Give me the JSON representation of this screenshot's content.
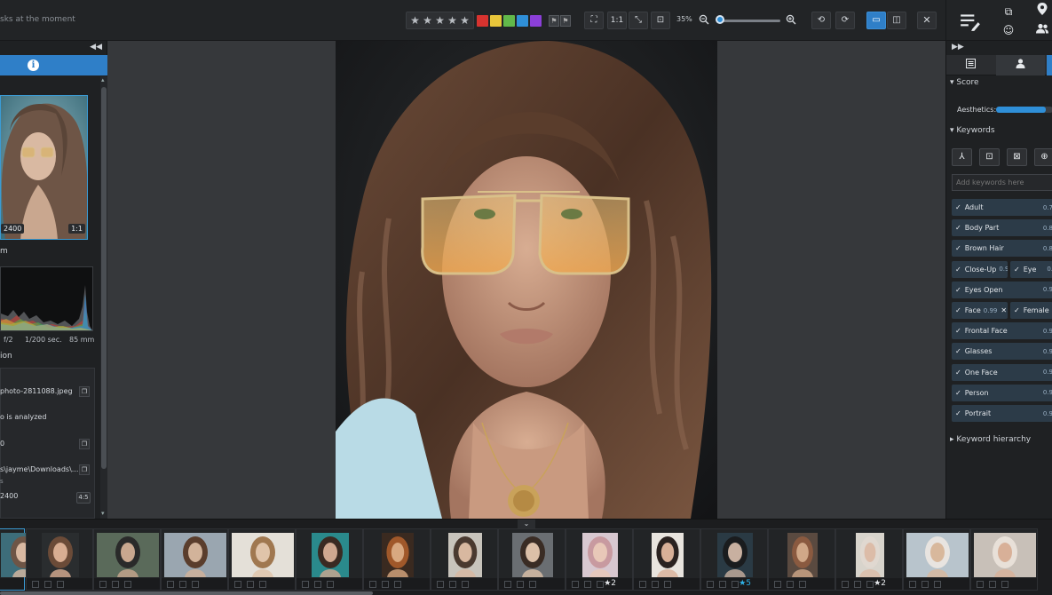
{
  "topbar": {
    "task_text": "sks at the moment",
    "rating_stars": [
      "★",
      "★",
      "★",
      "★",
      "★"
    ],
    "color_swatches": [
      "#d8332f",
      "#e8c53a",
      "#62b84a",
      "#2f8fd8",
      "#8b3fd8"
    ],
    "btn_fit": "⛶",
    "btn_1to1": "1:1",
    "btn_compress": "⤡",
    "btn_fill": "⊡",
    "zoom_value": "35%",
    "zoom_fraction": 0.35
  },
  "left_panel": {
    "preview_size": "2400",
    "preview_ratio": "1:1",
    "histogram_label": "m",
    "exif": {
      "aperture": "f/2",
      "shutter": "1/200 sec.",
      "focal": "85 mm"
    },
    "section_label": "ion",
    "filename": "photo-2811088.jpeg",
    "status": "o is analyzed",
    "value_0": "0",
    "path": "s\\jayme\\Downloads\\...",
    "path_sub": "s",
    "dims": "2400",
    "ratio": "4:5"
  },
  "right_panel": {
    "score_heading": "Score",
    "aesthetics_label": "Aesthetics:",
    "aesthetics_value": 0.88,
    "keywords_heading": "Keywords",
    "keyword_placeholder": "Add keywords here",
    "keyword_hierarchy": "Keyword hierarchy",
    "keywords": [
      [
        {
          "label": "Adult",
          "conf": "0.7"
        }
      ],
      [
        {
          "label": "Body Part",
          "conf": "0.8"
        }
      ],
      [
        {
          "label": "Brown Hair",
          "conf": "0.8"
        }
      ],
      [
        {
          "label": "Close-Up",
          "conf": "0.98",
          "x": true
        },
        {
          "label": "Eye",
          "conf": "0."
        }
      ],
      [
        {
          "label": "Eyes Open",
          "conf": "0.9"
        }
      ],
      [
        {
          "label": "Face",
          "conf": "0.99",
          "x": true
        },
        {
          "label": "Female",
          "conf": "0."
        }
      ],
      [
        {
          "label": "Frontal Face",
          "conf": "0.9"
        }
      ],
      [
        {
          "label": "Glasses",
          "conf": "0.9"
        }
      ],
      [
        {
          "label": "One Face",
          "conf": "0.9"
        }
      ],
      [
        {
          "label": "Person",
          "conf": "0.9"
        }
      ],
      [
        {
          "label": "Portrait",
          "conf": "0.9"
        }
      ]
    ]
  },
  "filmstrip": {
    "ratings": [
      "",
      "",
      "",
      "",
      "",
      "",
      "",
      "",
      "",
      "★2",
      "",
      "★5",
      "",
      "★2",
      "",
      ""
    ]
  }
}
